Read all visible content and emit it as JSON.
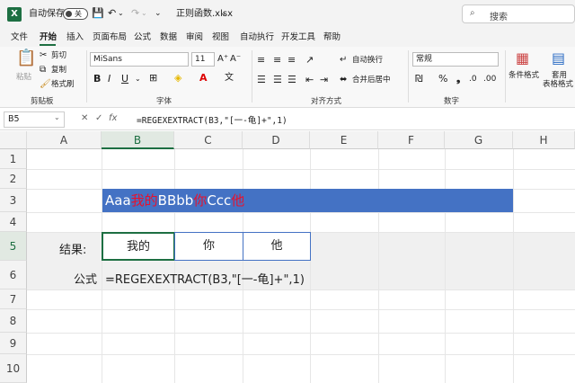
{
  "titlebar": {
    "logo": "X",
    "autosave_label": "自动保存",
    "autosave_state": "关",
    "filename": "正则函数.xlsx",
    "search_placeholder": "搜索",
    "search_icon": "search-icon"
  },
  "menu": {
    "items": [
      "文件",
      "开始",
      "插入",
      "页面布局",
      "公式",
      "数据",
      "审阅",
      "视图",
      "自动执行",
      "开发工具",
      "帮助"
    ],
    "active": "开始"
  },
  "ribbon": {
    "paste": "粘贴",
    "cut": "剪切",
    "copy": "复制",
    "format_painter": "格式刷",
    "clipboard_group": "剪贴板",
    "font_name": "MiSans",
    "font_size": "11",
    "font_group": "字体",
    "wrap_text": "自动换行",
    "merge_center": "合并后居中",
    "align_group": "对齐方式",
    "number_format": "常规",
    "number_group": "数字",
    "conditional_format": "条件格式",
    "format_as_table_1": "套用",
    "format_as_table_2": "表格格式"
  },
  "formula_bar": {
    "name_box": "B5",
    "fx": "fx",
    "formula": "=REGEXEXTRACT(B3,\"[一-龟]+\",1)"
  },
  "sheet": {
    "columns": [
      "A",
      "B",
      "C",
      "D",
      "E",
      "F",
      "G",
      "H"
    ],
    "rows": [
      "1",
      "2",
      "3",
      "4",
      "5",
      "6",
      "7",
      "8",
      "9",
      "10"
    ],
    "b3_segments": [
      {
        "text": "Aaa",
        "color": "#ffffff"
      },
      {
        "text": "我的",
        "color": "#e8112d"
      },
      {
        "text": "BBbb",
        "color": "#ffffff"
      },
      {
        "text": "你",
        "color": "#e8112d"
      },
      {
        "text": "Ccc",
        "color": "#ffffff"
      },
      {
        "text": "他",
        "color": "#e8112d"
      }
    ],
    "result_label": "结果:",
    "results": [
      "我的",
      "你",
      "他"
    ],
    "formula_label": "公式",
    "formula_display": "=REGEXEXTRACT(B3,\"[一-龟]+\",1)"
  },
  "colors": {
    "accent": "#1d6f42",
    "band": "#4472c4",
    "highlight": "#e8112d"
  }
}
